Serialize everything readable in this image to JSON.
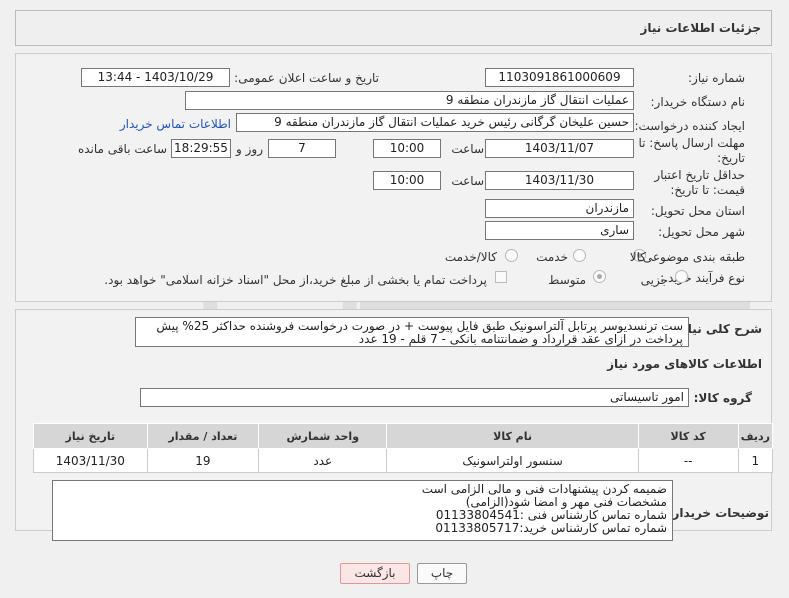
{
  "header": {
    "title": "جزئیات اطلاعات نیاز"
  },
  "fields": {
    "need_number_label": "شماره نیاز:",
    "need_number": "1103091861000609",
    "announce_label": "تاریخ و ساعت اعلان عمومی:",
    "announce_value": "1403/10/29 - 13:44",
    "buyer_org_label": "نام دستگاه خریدار:",
    "buyer_org": "عملیات انتقال گاز مازندران منطقه 9",
    "creator_label": "ایجاد کننده درخواست:",
    "creator": "حسین علیخان گرگانی رئیس خرید عملیات انتقال گاز مازندران منطقه 9",
    "contact_link": "اطلاعات تماس خریدار",
    "deadline_label": "مهلت ارسال پاسخ: تا تاریخ:",
    "deadline_date": "1403/11/07",
    "time_label": "ساعت",
    "deadline_time": "10:00",
    "days_value": "7",
    "days_label": "روز و",
    "remaining_time": "18:29:55",
    "remaining_label": "ساعت باقی مانده",
    "validity_label": "حداقل تاریخ اعتبار قیمت: تا تاریخ:",
    "validity_date": "1403/11/30",
    "validity_time": "10:00",
    "province_label": "استان محل تحویل:",
    "province": "مازندران",
    "city_label": "شهر محل تحویل:",
    "city": "ساری",
    "category_label": "طبقه بندی موضوعی:",
    "category_options": [
      "کالا",
      "خدمت",
      "کالا/خدمت"
    ],
    "process_label": "نوع فرآیند خرید :",
    "process_options": [
      "جزیی",
      "متوسط"
    ],
    "payment_note": "پرداخت تمام یا بخشی از مبلغ خرید،از محل \"اسناد خزانه اسلامی\" خواهد بود."
  },
  "description": {
    "label": "شرح کلی نیاز:",
    "text": "ست ترنسدیوسر پرتابل آلتراسونیک طبق فایل پیوست + در صورت درخواست فروشنده حداکثر 25% پیش پرداخت در ازای عقد قرارداد و ضمانتنامه بانکی - 7 قلم - 19 عدد"
  },
  "goods": {
    "section_title": "اطلاعات کالاهای مورد نیاز",
    "group_label": "گروه کالا:",
    "group_value": "امور تاسیساتی",
    "columns": [
      "ردیف",
      "کد کالا",
      "نام کالا",
      "واحد شمارش",
      "تعداد / مقدار",
      "تاریخ نیاز"
    ],
    "rows": [
      {
        "row": "1",
        "code": "--",
        "name": "سنسور اولتراسونیک",
        "unit": "عدد",
        "qty": "19",
        "date": "1403/11/30"
      }
    ]
  },
  "buyer_notes": {
    "label": "توضیحات خریدار:",
    "lines": [
      "ضمیمه کردن پیشنهادات فنی و مالی الزامی است",
      "مشخصات فنی مهر و امضا شود(الزامی)",
      "شماره تماس کارشناس فنی :01133804541",
      "شماره تماس کارشناس خرید:01133805717"
    ]
  },
  "buttons": {
    "print": "چاپ",
    "back": "بازگشت"
  },
  "colors": {
    "link": "#2255bb",
    "header_bg": "#efefef",
    "table_header": "#d6d6d6"
  }
}
